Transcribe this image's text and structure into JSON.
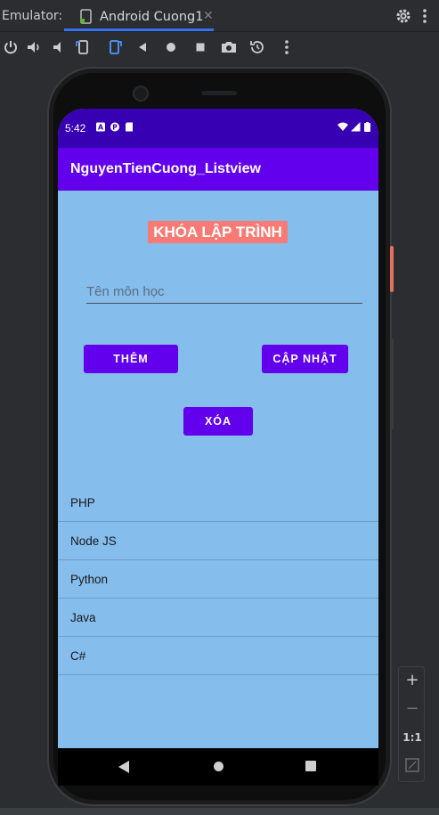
{
  "emulator": {
    "label": "Emulator:",
    "tab_name": "Android Cuong1",
    "tab_close": "✕"
  },
  "toolbar_icons": [
    "power-icon",
    "volume-up-icon",
    "volume-down-icon",
    "rotate-left-icon",
    "rotate-right-icon",
    "back-icon",
    "home-icon",
    "overview-icon",
    "camera-icon",
    "snapshot-icon",
    "more-icon"
  ],
  "status": {
    "time": "5:42",
    "notif_letter_a": "A"
  },
  "app": {
    "title": "NguyenTienCuong_Listview",
    "heading": "KHÓA LẬP TRÌNH",
    "input_placeholder": "Tên môn học",
    "input_value": "",
    "btn_add": "THÊM",
    "btn_update": "CẬP NHẬT",
    "btn_delete": "XÓA",
    "list": [
      "PHP",
      "Node JS",
      "Python",
      "Java",
      "C#"
    ]
  },
  "zoom": {
    "plus": "+",
    "minus": "−",
    "ratio": "1:1"
  },
  "colors": {
    "status_bar": "#3700b3",
    "app_bar": "#6200ee",
    "background": "#85bdec",
    "heading_bg": "#f77b74",
    "button": "#6200ee",
    "tab_underline": "#3574f0"
  }
}
